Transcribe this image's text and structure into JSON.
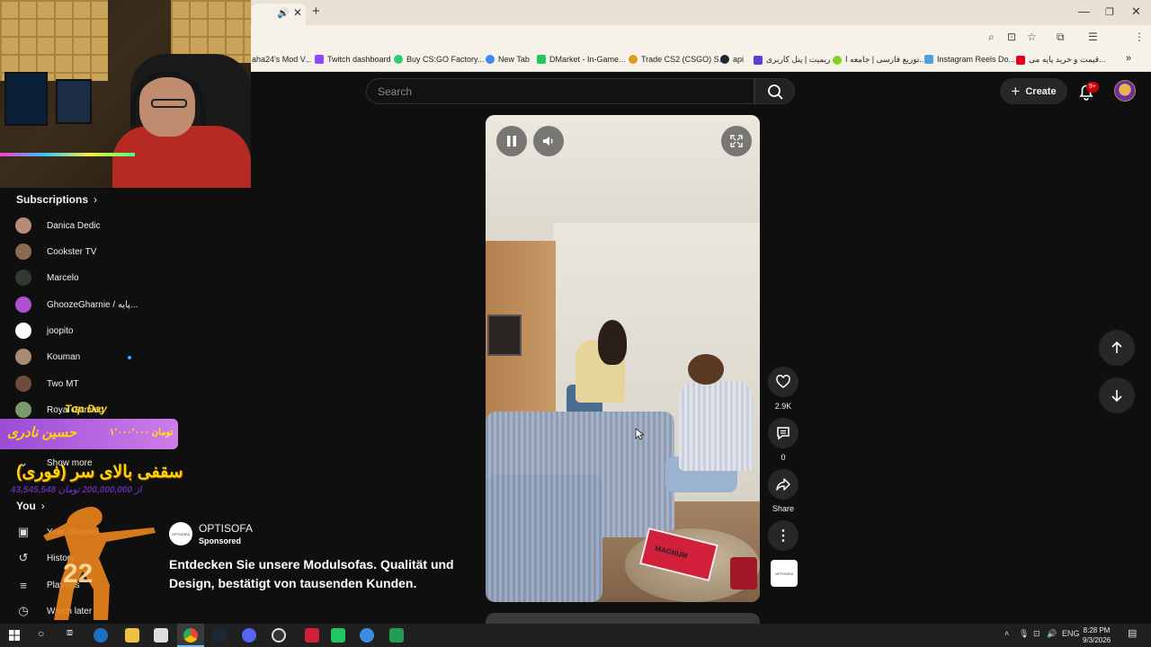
{
  "browser": {
    "bookmarks": [
      {
        "label": "aha24's Mod V...",
        "color": "#ffffff"
      },
      {
        "label": "Twitch dashboard",
        "color": "#9146ff"
      },
      {
        "label": "Buy CS:GO Factory...",
        "color": "#2ecc71"
      },
      {
        "label": "New Tab",
        "color": "#4285f4"
      },
      {
        "label": "DMarket - In-Game...",
        "color": "#22c55e"
      },
      {
        "label": "Trade CS2 (CSGO) S...",
        "color": "#d4a017"
      },
      {
        "label": "api",
        "color": "#1b2838"
      },
      {
        "label": "ریمیت | پنل کاربری",
        "color": "#5b3fd1"
      },
      {
        "label": "توزیع فارسی | جامعه ا...",
        "color": "#7ed321"
      },
      {
        "label": "Instagram Reels Do...",
        "color": "#4aa3df"
      },
      {
        "label": "قیمت و خرید پایه می...",
        "color": "#e3001b"
      }
    ]
  },
  "header": {
    "search_placeholder": "Search",
    "create_label": "Create",
    "notif_badge": "9+"
  },
  "sidebar": {
    "subscriptions_title": "Subscriptions",
    "subscriptions": [
      {
        "name": "Danica Dedic",
        "color": "#b98a76"
      },
      {
        "name": "Cookster TV",
        "color": "#8a6a52"
      },
      {
        "name": "Marcelo",
        "color": "#2f3b2f"
      },
      {
        "name": "GhoozeGharnie / پایه...",
        "color": "#b04fd0"
      },
      {
        "name": "joopito",
        "color": "#ffffff"
      },
      {
        "name": "Kouman",
        "color": "#a98b72"
      },
      {
        "name": "Two MT",
        "color": "#6d4c3d"
      },
      {
        "name": "Royal Gaming",
        "color": "#7a9b6a"
      }
    ],
    "show_more": "Show more",
    "you_title": "You",
    "you_items": [
      {
        "label": "Your channel",
        "icon": "user-square-icon"
      },
      {
        "label": "History",
        "icon": "history-icon"
      },
      {
        "label": "Playlists",
        "icon": "playlist-icon"
      },
      {
        "label": "Watch later",
        "icon": "clock-icon"
      }
    ]
  },
  "overlay": {
    "top_day_label": "Top Day",
    "donation_name": "حسین نادری",
    "donation_amount": "۱٬۰۰۰٬۰۰۰ تومان",
    "goal_title": "سقفی بالای سر (فوری)",
    "goal_amount": "43,545,548 از 200,000,000 تومان",
    "kill_count": "22"
  },
  "ad": {
    "advertiser": "OPTISOFA",
    "logo_text": "OPTISOFA",
    "sponsored": "Sponsored",
    "headline": "Entdecken Sie unsere Modulsofas. Qualität und Design, bestätigt von tausenden Kunden."
  },
  "video": {
    "book_text": "MAGNUM",
    "likes": "2.9K",
    "comments": "0",
    "share_label": "Share",
    "channel_thumb_text": "OPTISOFA"
  },
  "taskbar": {
    "lang": "ENG",
    "time": "8:28 PM",
    "date": "9/3/2026"
  }
}
